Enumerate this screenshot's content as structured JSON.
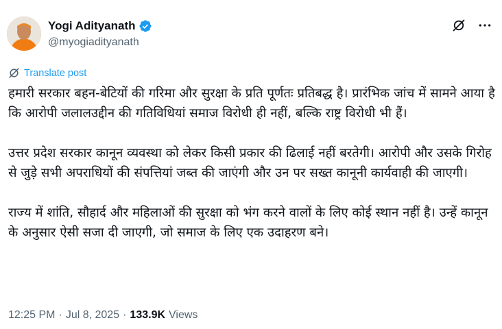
{
  "author": {
    "name": "Yogi Adityanath",
    "handle": "@myogiadityanath",
    "verified_icon": "verified-badge-icon"
  },
  "actions": {
    "grok_icon": "grok-icon",
    "more_icon": "more-icon"
  },
  "translate": {
    "icon": "translate-icon",
    "label": "Translate post"
  },
  "post": {
    "paragraphs": [
      "हमारी सरकार बहन-बेटियों की गरिमा और सुरक्षा के प्रति पूर्णतः प्रतिबद्ध है। प्रारंभिक जांच में सामने आया है कि आरोपी जलालउद्दीन की गतिविधियां समाज विरोधी ही नहीं, बल्कि राष्ट्र विरोधी भी हैं।",
      "उत्तर प्रदेश सरकार कानून व्यवस्था को लेकर किसी प्रकार की ढिलाई नहीं बरतेगी। आरोपी और उसके गिरोह से जुड़े सभी अपराधियों की संपत्तियां जब्त की जाएंगी और उन पर सख्त कानूनी कार्यवाही की जाएगी।",
      "राज्य में शांति, सौहार्द और महिलाओं की सुरक्षा को भंग करने वालों के लिए कोई स्थान नहीं है। उन्हें कानून के अनुसार ऐसी सजा दी जाएगी, जो समाज के लिए एक उदाहरण बने।"
    ]
  },
  "meta": {
    "time": "12:25 PM",
    "separator": "·",
    "date": "Jul 8, 2025",
    "views_count": "133.9K",
    "views_label": "Views"
  },
  "colors": {
    "accent": "#1d9bf0",
    "secondary_text": "#536471",
    "primary_text": "#0f1419"
  }
}
